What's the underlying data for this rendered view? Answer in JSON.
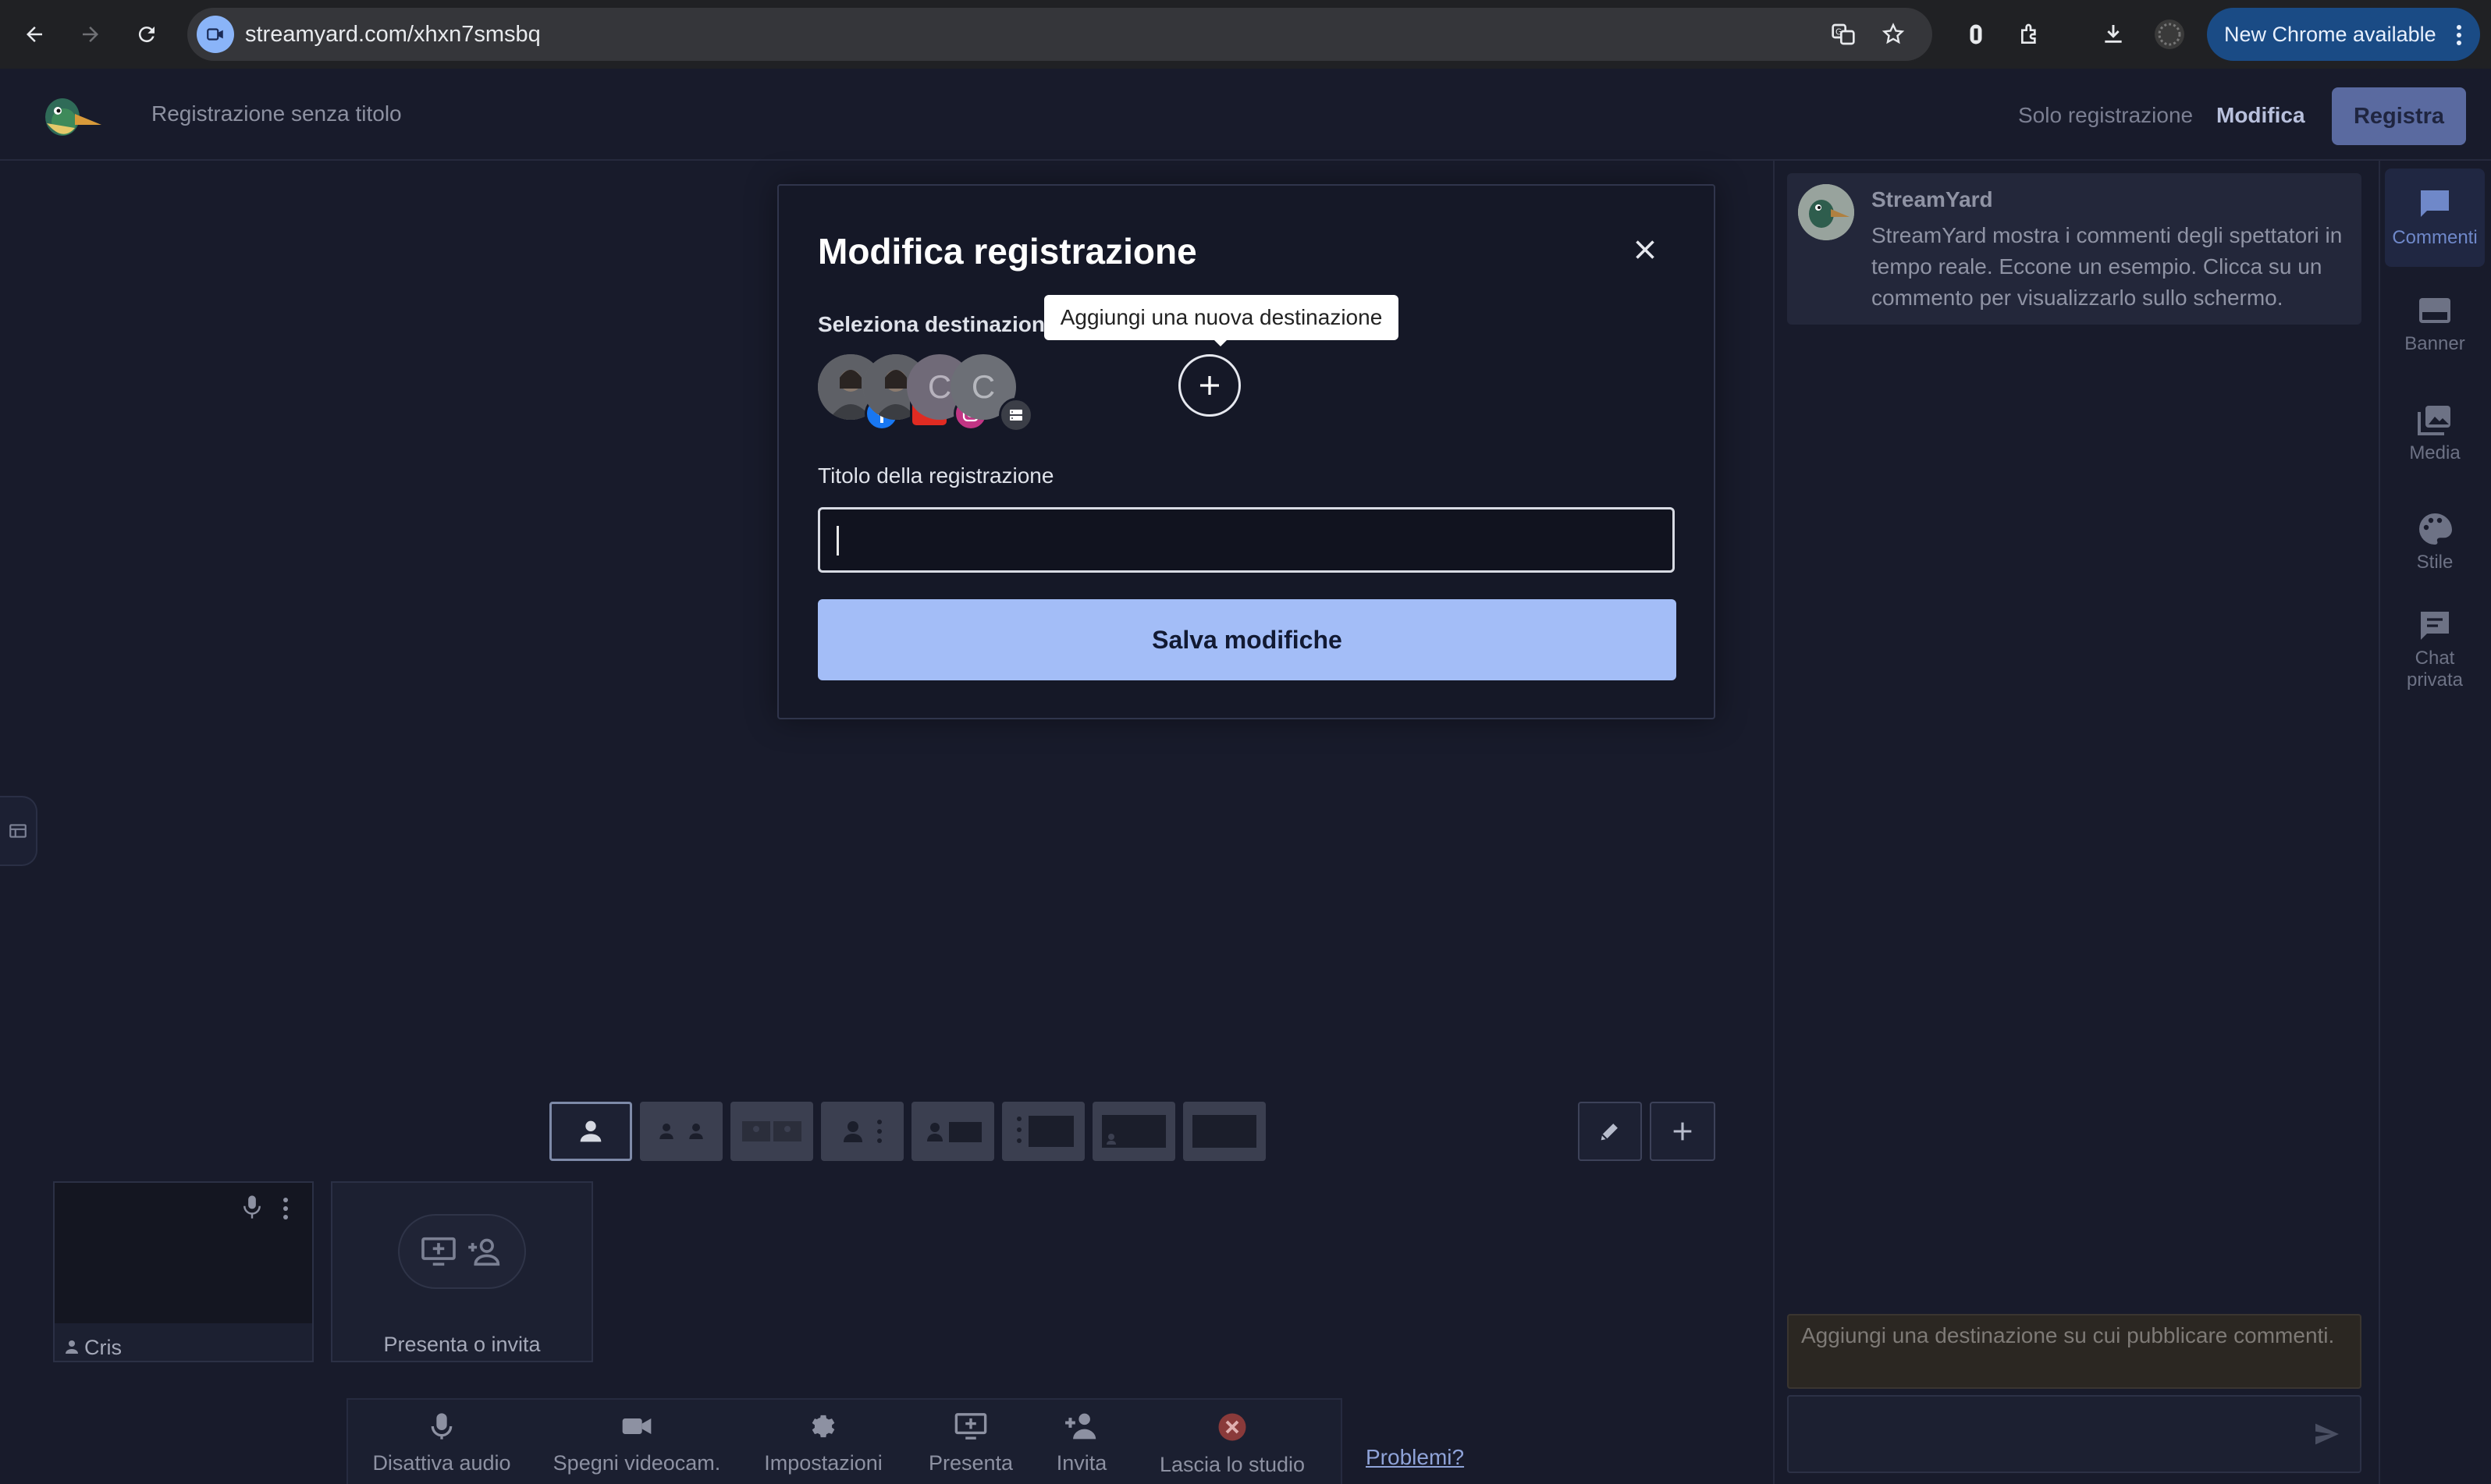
{
  "browser": {
    "url": "streamyard.com/xhxn7smsbq",
    "update_button": "New Chrome available"
  },
  "header": {
    "recording_title": "Registrazione senza titolo",
    "mode_label": "Solo registrazione",
    "edit_link": "Modifica",
    "record_button": "Registra"
  },
  "modal": {
    "title": "Modifica registrazione",
    "destinations_label": "Seleziona destinazioni",
    "tooltip": "Aggiungi una nuova destinazione",
    "destinations": [
      {
        "type": "facebook",
        "initial": ""
      },
      {
        "type": "youtube",
        "initial": ""
      },
      {
        "type": "instagram",
        "initial": "C"
      },
      {
        "type": "rtmp",
        "initial": "C"
      }
    ],
    "title_field_label": "Titolo della registrazione",
    "title_field_value": "",
    "save_button": "Salva modifiche"
  },
  "participants": {
    "self_name": "Cris",
    "invite_label": "Presenta o invita"
  },
  "toolbar": {
    "mute": "Disattiva audio",
    "camera": "Spegni videocam.",
    "settings": "Impostazioni",
    "present": "Presenta",
    "invite": "Invita",
    "leave": "Lascia lo studio",
    "problems": "Problemi?"
  },
  "comments": {
    "author": "StreamYard",
    "text": "StreamYard mostra i commenti degli spettatori in tempo reale. Eccone un esempio. Clicca su un commento per visualizzarlo sullo schermo.",
    "notice": "Aggiungi una destinazione su cui pubblicare commenti."
  },
  "sidebar": {
    "items": [
      {
        "label": "Commenti",
        "icon": "comment-icon"
      },
      {
        "label": "Banner",
        "icon": "banner-icon"
      },
      {
        "label": "Media",
        "icon": "media-icon"
      },
      {
        "label": "Stile",
        "icon": "palette-icon"
      },
      {
        "label": "Chat\nprivata",
        "icon": "chat-icon"
      }
    ]
  },
  "colors": {
    "background": "#181b2b",
    "accent": "#a3bdf7",
    "modal": "#151827"
  }
}
